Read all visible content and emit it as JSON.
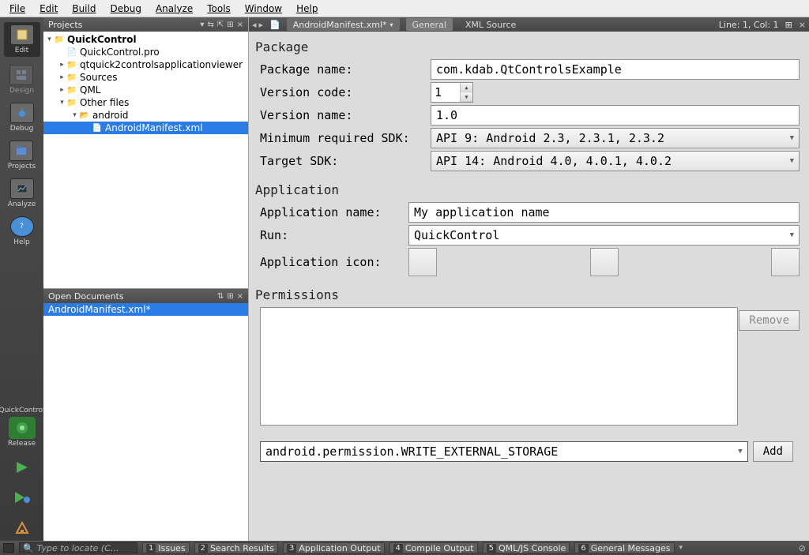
{
  "menu": {
    "file": "File",
    "edit": "Edit",
    "build": "Build",
    "debug": "Debug",
    "analyze": "Analyze",
    "tools": "Tools",
    "window": "Window",
    "help": "Help"
  },
  "modes": {
    "edit": "Edit",
    "design": "Design",
    "debug": "Debug",
    "projects": "Projects",
    "analyze": "Analyze",
    "help": "Help"
  },
  "kit": {
    "name": "QuickControl",
    "build": "Release"
  },
  "projects_panel": {
    "title": "Projects",
    "root": "QuickControl",
    "items": [
      "QuickControl.pro",
      "qtquick2controlsapplicationviewer",
      "Sources",
      "QML",
      "Other files"
    ],
    "android": "android",
    "manifest": "AndroidManifest.xml"
  },
  "open_docs": {
    "title": "Open Documents",
    "items": [
      "AndroidManifest.xml*"
    ]
  },
  "tabbar": {
    "file": "AndroidManifest.xml*",
    "general": "General",
    "xml": "XML Source",
    "linecol": "Line: 1, Col: 1"
  },
  "form": {
    "package_section": "Package",
    "package_name_lbl": "Package name:",
    "package_name": "com.kdab.QtControlsExample",
    "version_code_lbl": "Version code:",
    "version_code": "1",
    "version_name_lbl": "Version name:",
    "version_name": "1.0",
    "min_sdk_lbl": "Minimum required SDK:",
    "min_sdk": "API 9: Android 2.3, 2.3.1, 2.3.2",
    "target_sdk_lbl": "Target SDK:",
    "target_sdk": "API 14: Android 4.0, 4.0.1, 4.0.2",
    "application_section": "Application",
    "app_name_lbl": "Application name:",
    "app_name": "My application name",
    "run_lbl": "Run:",
    "run": "QuickControl",
    "app_icon_lbl": "Application icon:",
    "permissions_section": "Permissions",
    "perm_remove": "Remove",
    "perm_add": "Add",
    "perm_value": "android.permission.WRITE_EXTERNAL_STORAGE"
  },
  "status": {
    "locator_placeholder": "Type to locate (C…",
    "panels": [
      "Issues",
      "Search Results",
      "Application Output",
      "Compile Output",
      "QML/JS Console",
      "General Messages"
    ]
  }
}
